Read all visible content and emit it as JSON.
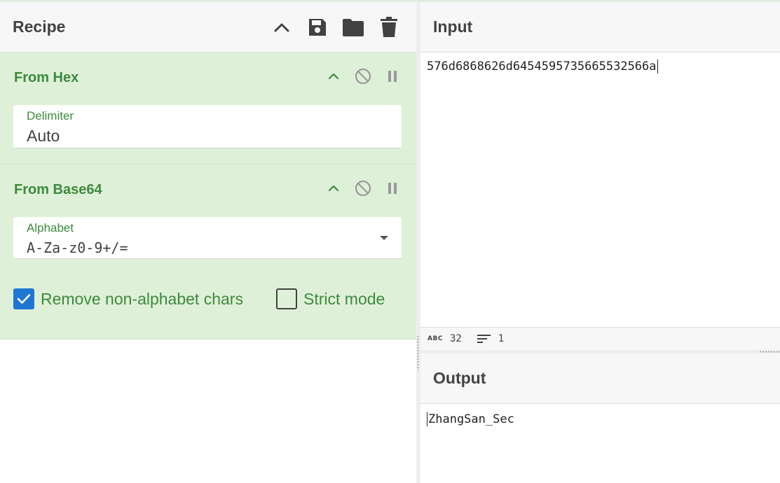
{
  "recipe": {
    "title": "Recipe",
    "header_icons": [
      "chevron-up-icon",
      "save-icon",
      "folder-icon",
      "trash-icon"
    ],
    "operations": [
      {
        "name": "From Hex",
        "field": {
          "label": "Delimiter",
          "value": "Auto"
        }
      },
      {
        "name": "From Base64",
        "field": {
          "label": "Alphabet",
          "value": "A-Za-z0-9+/="
        },
        "options": [
          {
            "label": "Remove non-alphabet chars",
            "checked": true
          },
          {
            "label": "Strict mode",
            "checked": false
          }
        ]
      }
    ]
  },
  "input": {
    "title": "Input",
    "text": "576d6868626d6454595735665532566a",
    "stats": {
      "length": "32",
      "lines": "1"
    }
  },
  "output": {
    "title": "Output",
    "text": "ZhangSan_Sec"
  },
  "colors": {
    "op_background": "#dff0d8",
    "op_text": "#3c8a3c",
    "checkbox_checked": "#1e76d3"
  }
}
